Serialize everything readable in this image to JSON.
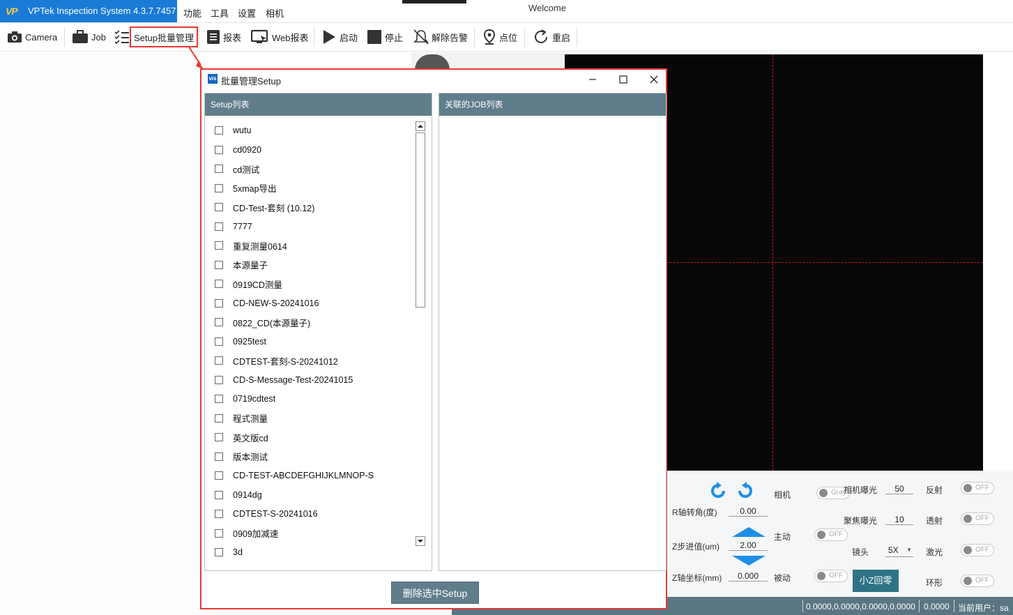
{
  "app": {
    "logo_text": "VP",
    "title": "VPTek Inspection System 4.3.7.7457",
    "welcome": "Welcome"
  },
  "menu": [
    "功能",
    "工具",
    "设置",
    "相机"
  ],
  "toolbar": {
    "camera": "Camera",
    "job": "Job",
    "setup": "Setup批量管理",
    "report": "报表",
    "web_report": "Web报表",
    "start": "启动",
    "stop": "停止",
    "clear_alarm": "解除告警",
    "point": "点位",
    "restart": "重启"
  },
  "dialog": {
    "icon_text": "vis",
    "title": "批量管理Setup",
    "setup_list_header": "Setup列表",
    "job_list_header": "关联的JOB列表",
    "setups": [
      "wutu",
      "cd0920",
      "cd测试",
      "5xmap导出",
      "CD-Test-套刻 (10.12)",
      "7777",
      "重复测量0614",
      "本源量子",
      "0919CD测量",
      "CD-NEW-S-20241016",
      "0822_CD(本源量子)",
      "0925test",
      "CDTEST-套刻-S-20241012",
      "CD-S-Message-Test-20241015",
      "0719cdtest",
      "程式测量",
      "英文版cd",
      "版本测试",
      "CD-TEST-ABCDEFGHIJKLMNOP-S",
      "0914dg",
      "CDTEST-S-20241016",
      "0909加减速",
      "3d"
    ],
    "delete_button": "删除选中Setup"
  },
  "control_panel": {
    "r_rotation_label": "R轴转角(度)",
    "r_rotation_value": "0.00",
    "z_step_label": "Z步进值(um)",
    "z_step_value": "2.00",
    "z_coord_label": "Z轴坐标(mm)",
    "z_coord_value": "0.000",
    "camera_label": "相机",
    "camera_toggle": "Gray",
    "active_label": "主动",
    "active_toggle": "OFF",
    "passive_label": "被动",
    "passive_toggle": "OFF",
    "camera_exposure_label": "相机曝光",
    "camera_exposure_value": "50",
    "focus_exposure_label": "聚焦曝光",
    "focus_exposure_value": "10",
    "lens_label": "镜头",
    "lens_value": "5X",
    "reflect_label": "反射",
    "reflect_toggle": "OFF",
    "transmit_label": "透射",
    "transmit_toggle": "OFF",
    "laser_label": "激光",
    "laser_toggle": "OFF",
    "ring_label": "环形",
    "ring_toggle": "OFF",
    "zero_button": "小Z回零"
  },
  "status": {
    "coords": "0.0000,0.0000,0.0000,0.0000",
    "value": "0.0000",
    "user": "当前用户：sa"
  }
}
